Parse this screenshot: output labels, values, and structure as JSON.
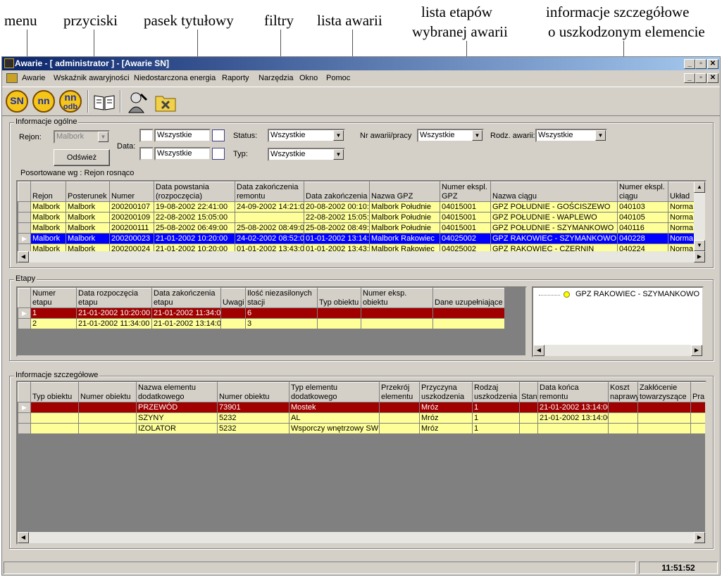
{
  "annotations": [
    "menu",
    "przyciski",
    "pasek tytułowy",
    "filtry",
    "lista awarii",
    "lista etapów",
    "wybranej awarii",
    "informacje  szczegółowe",
    "o uszkodzonym elemencie"
  ],
  "window": {
    "title": "Awarie - [ administrator ] - [Awarie SN]"
  },
  "menu": [
    "Awarie",
    "Wskaźnik awaryjności",
    "Niedostarczona energia",
    "Raporty",
    "Narzędzia",
    "Okno",
    "Pomoc"
  ],
  "toolbar": {
    "sn": "SN",
    "nn": "nn",
    "nnodb_top": "nn",
    "nnodb_bottom": "odb"
  },
  "general": {
    "legend": "Informacje ogólne",
    "rejon_label": "Rejon:",
    "rejon_value": "Malbork",
    "refresh_label": "Odśwież",
    "data_label": "Data:",
    "date1": "Wszystkie",
    "date2": "Wszystkie",
    "status_label": "Status:",
    "status_value": "Wszystkie",
    "typ_label": "Typ:",
    "typ_value": "Wszystkie",
    "nr_label": "Nr awarii/pracy",
    "nr_value": "Wszystkie",
    "rodz_label": "Rodz. awarii:",
    "rodz_value": "Wszystkie",
    "sorted": "Posortowane wg : Rejon rosnąco"
  },
  "failures": {
    "headers": [
      "Rejon",
      "Posterunek",
      "Numer",
      "Data powstania (rozpoczęcia)",
      "Data zakończenia remontu",
      "Data zakończenia",
      "Nazwa GPZ",
      "Numer ekspl. GPZ",
      "Nazwa ciągu",
      "Numer ekspl. ciągu",
      "Układ"
    ],
    "rows": [
      [
        "Malbork",
        "Malbork",
        "200200107",
        "19-08-2002 22:41:00",
        "24-09-2002 14:21:00",
        "20-08-2002 00:10:00",
        "Malbork Południe",
        "04015001",
        "GPZ POŁUDNIE - GOŚCISZEWO",
        "040103",
        "Norma"
      ],
      [
        "Malbork",
        "Malbork",
        "200200109",
        "22-08-2002 15:05:00",
        "",
        "22-08-2002 15:05:00",
        "Malbork Południe",
        "04015001",
        "GPZ POŁUDNIE - WAPLEWO",
        "040105",
        "Norma"
      ],
      [
        "Malbork",
        "Malbork",
        "200200111",
        "25-08-2002 06:49:00",
        "25-08-2002 08:49:00",
        "25-08-2002 08:49:00",
        "Malbork Południe",
        "04015001",
        "GPZ POŁUDNIE - SZYMANKOWO",
        "040116",
        "Norma"
      ],
      [
        "Malbork",
        "Malbork",
        "200200023",
        "21-01-2002 10:20:00",
        "24-02-2002 08:52:00",
        "01-01-2002 13:14:00",
        "Malbork Rakowiec",
        "04025002",
        "GPZ RAKOWIEC - SZYMANKOWO",
        "040228",
        "Norma"
      ],
      [
        "Malbork",
        "Malbork",
        "200200024",
        "21-01-2002 10:20:00",
        "01-01-2002 13:43:00",
        "01-01-2002 13:43:00",
        "Malbork Rakowiec",
        "04025002",
        "GPZ RAKOWIEC - CZERNIN",
        "040224",
        "Norma"
      ]
    ]
  },
  "stages": {
    "legend": "Etapy",
    "headers": [
      "Numer etapu",
      "Data rozpoczęcia etapu",
      "Data zakończenia etapu",
      "Uwagi",
      "Ilość niezasilonych stacji",
      "Typ obiektu",
      "Numer eksp. obiektu",
      "Dane uzupełniające"
    ],
    "rows": [
      [
        "1",
        "21-01-2002 10:20:00",
        "21-01-2002 11:34:00",
        "",
        "6",
        "",
        "",
        ""
      ],
      [
        "2",
        "21-01-2002 11:34:00",
        "21-01-2002 13:14:00",
        "",
        "3",
        "",
        "",
        ""
      ]
    ],
    "tree_item": "GPZ RAKOWIEC - SZYMANKOWO"
  },
  "details": {
    "legend": "Informacje szczegółowe",
    "headers": [
      "Typ obiektu",
      "Numer obiektu",
      "Nazwa elementu dodatkowego",
      "Numer obiektu",
      "Typ elementu dodatkowego",
      "Przekrój elementu",
      "Przyczyna uszkodzenia",
      "Rodzaj uszkodzenia",
      "Stan",
      "Data końca remontu",
      "Koszt naprawy",
      "Zakłócenie towarzyszące",
      "Pra"
    ],
    "rows": [
      [
        "",
        "",
        "PRZEWÓD",
        "73901",
        "Mostek",
        "",
        "Mróz",
        "1",
        "",
        "21-01-2002 13:14:00",
        "",
        "",
        ""
      ],
      [
        "",
        "",
        "SZYNY",
        "5232",
        "AL",
        "",
        "Mróz",
        "1",
        "",
        "21-01-2002 13:14:00",
        "",
        "",
        ""
      ],
      [
        "",
        "",
        "IZOLATOR",
        "5232",
        "Wsporczy wnętrzowy SW",
        "",
        "Mróz",
        "1",
        "",
        "",
        "",
        "",
        ""
      ]
    ]
  },
  "status": {
    "time": "11:51:52"
  },
  "colors": {
    "selected": "#0000ff",
    "yellow": "#ffff99",
    "red": "#a00000",
    "titlebar": "#0a246a"
  }
}
